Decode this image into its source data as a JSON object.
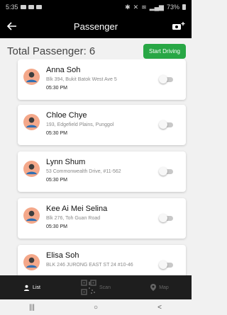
{
  "status_bar": {
    "time": "5:35",
    "battery": "73%"
  },
  "app_bar": {
    "title": "Passenger",
    "back_icon": "arrow-left-icon",
    "share_icon": "share-icon"
  },
  "header": {
    "total_label": "Total Passenger: 6",
    "start_button": "Start Driving",
    "accent": "#28a745"
  },
  "passengers": [
    {
      "name": "Anna Soh",
      "address": "Blk 394, Bukit Batok West Ave 5",
      "time": "05:30 PM",
      "enabled": false
    },
    {
      "name": "Chloe Chye",
      "address": "193, Edgefield Plains, Punggol",
      "time": "05:30 PM",
      "enabled": false
    },
    {
      "name": "Lynn Shum",
      "address": "53 Commonwealth Drive, #11-562",
      "time": "05:30 PM",
      "enabled": false
    },
    {
      "name": "Kee Ai Mei Selina",
      "address": "Blk 276, Toh Guan Road",
      "time": "05:30 PM",
      "enabled": false
    },
    {
      "name": "Elisa Soh",
      "address": "BLK 246 JURONG EAST ST 24 #10-46",
      "time": "",
      "enabled": false
    }
  ],
  "tabs": [
    {
      "label": "List",
      "icon": "person-icon",
      "active": true
    },
    {
      "label": "Scan",
      "icon": "qr-code-icon",
      "active": false
    },
    {
      "label": "Map",
      "icon": "map-pin-icon",
      "active": false
    }
  ],
  "nav": {
    "recents": "|||",
    "home": "○",
    "back": "<"
  }
}
